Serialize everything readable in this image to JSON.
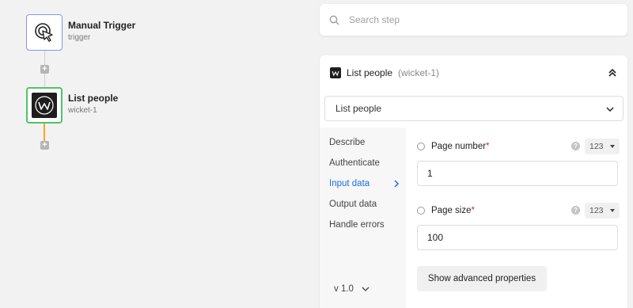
{
  "flow": {
    "trigger": {
      "title": "Manual Trigger",
      "subtitle": "trigger"
    },
    "step": {
      "title": "List people",
      "subtitle": "wicket-1"
    },
    "add_label": "+"
  },
  "search": {
    "placeholder": "Search step"
  },
  "panel": {
    "title": "List people",
    "subtitle": "(wicket-1)",
    "action_value": "List people",
    "nav": [
      "Describe",
      "Authenticate",
      "Input data",
      "Output data",
      "Handle errors"
    ],
    "active_nav": "Input data",
    "version": "v 1.0",
    "props": [
      {
        "label": "Page number",
        "required": "*",
        "help": "?",
        "type": "123",
        "value": "1"
      },
      {
        "label": "Page size",
        "required": "*",
        "help": "?",
        "type": "123",
        "value": "100"
      }
    ],
    "advanced_label": "Show advanced properties"
  },
  "colors": {
    "accent": "#1a6ee0",
    "trigger_border": "#8a93e0",
    "step_border": "#4cc467",
    "connector": "#f5a623",
    "required": "#d0312d"
  }
}
